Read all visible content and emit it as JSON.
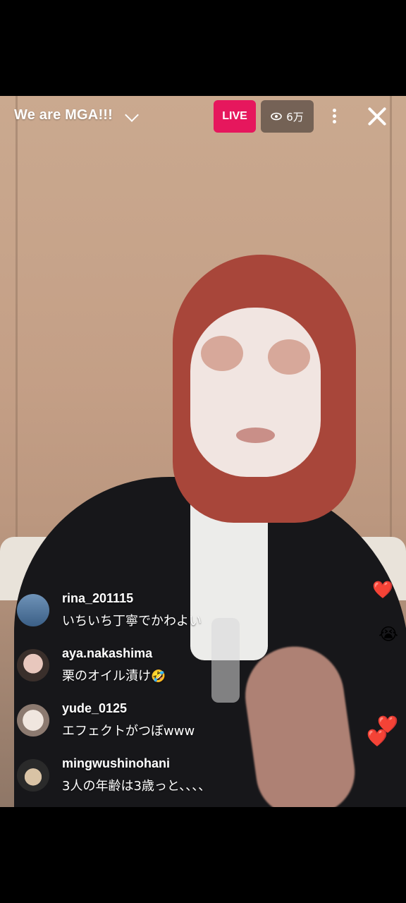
{
  "header": {
    "title": "We are MGA!!!",
    "live_label": "LIVE",
    "viewer_count": "6万"
  },
  "comments": [
    {
      "username": "rina_201115",
      "text": "いちいち丁寧でかわよい",
      "emoji": ""
    },
    {
      "username": "aya.nakashima",
      "text": "栗のオイル漬け",
      "emoji": "🤣"
    },
    {
      "username": "yude_0125",
      "text": "エフェクトがつぼwww",
      "emoji": ""
    },
    {
      "username": "mingwushinohani",
      "text": "3人の年齢は3歳っと、、、、",
      "emoji": ""
    }
  ],
  "reactions": [
    "❤️",
    "😭",
    "❤️",
    "❤️"
  ],
  "colors": {
    "live": "#e6175d",
    "badge_bg": "#463c37",
    "text": "#ffffff"
  }
}
